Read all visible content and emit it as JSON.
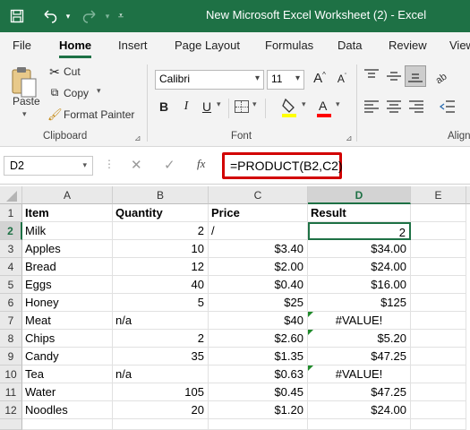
{
  "window": {
    "title": "New Microsoft Excel Worksheet (2)  -  Excel",
    "icons": [
      "save-icon",
      "undo-icon",
      "redo-icon",
      "customize-icon"
    ]
  },
  "ribbon_tabs": [
    "File",
    "Home",
    "Insert",
    "Page Layout",
    "Formulas",
    "Data",
    "Review",
    "View"
  ],
  "active_tab": "Home",
  "clipboard": {
    "paste_label": "Paste",
    "cut_label": "Cut",
    "copy_label": "Copy",
    "format_painter_label": "Format Painter",
    "group_label": "Clipboard"
  },
  "font": {
    "name": "Calibri",
    "size": "11",
    "bold": "B",
    "italic": "I",
    "underline": "U",
    "group_label": "Font",
    "fill_color": "#ffff00",
    "font_color": "#ff0000"
  },
  "alignment": {
    "group_label": "Align"
  },
  "formula_bar": {
    "name_box": "D2",
    "formula": "=PRODUCT(B2,C2)",
    "fx_label": "fx"
  },
  "colors": {
    "accent": "#1e7145",
    "highlight": "#d20000"
  },
  "sheet": {
    "columns": [
      "A",
      "B",
      "C",
      "D",
      "E"
    ],
    "rows": [
      [
        "1",
        "Item",
        "Quantity",
        "Price",
        "Result",
        ""
      ],
      [
        "2",
        "Milk",
        "2",
        "/",
        "2",
        ""
      ],
      [
        "3",
        "Apples",
        "10",
        "$3.40",
        "$34.00",
        ""
      ],
      [
        "4",
        "Bread",
        "12",
        "$2.00",
        "$24.00",
        ""
      ],
      [
        "5",
        "Eggs",
        "40",
        "$0.40",
        "$16.00",
        ""
      ],
      [
        "6",
        "Honey",
        "5",
        "$25",
        "$125",
        ""
      ],
      [
        "7",
        "Meat",
        "n/a",
        "$40",
        "#VALUE!",
        ""
      ],
      [
        "8",
        "Chips",
        "2",
        "$2.60",
        "$5.20",
        ""
      ],
      [
        "9",
        "Candy",
        "35",
        "$1.35",
        "$47.25",
        ""
      ],
      [
        "10",
        "Tea",
        "n/a",
        "$0.63",
        "#VALUE!",
        ""
      ],
      [
        "11",
        "Water",
        "105",
        "$0.45",
        "$47.25",
        ""
      ],
      [
        "12",
        "Noodles",
        "20",
        "$1.20",
        "$24.00",
        ""
      ]
    ],
    "active_cell": "D2"
  }
}
